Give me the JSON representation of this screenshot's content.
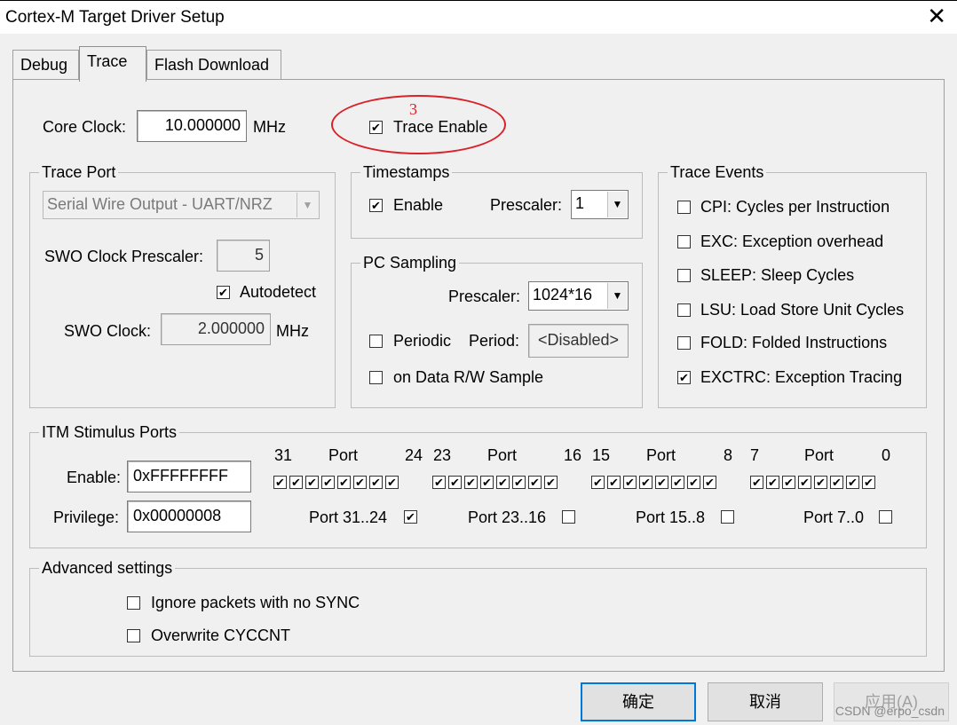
{
  "window": {
    "title": "Cortex-M Target Driver Setup"
  },
  "tabs": [
    {
      "label": "Debug"
    },
    {
      "label": "Trace"
    },
    {
      "label": "Flash Download"
    }
  ],
  "core_clock": {
    "label": "Core Clock:",
    "value": "10.000000",
    "unit": "MHz"
  },
  "trace_enable": {
    "label": "Trace Enable",
    "checked": true
  },
  "annotation": {
    "number": "3"
  },
  "trace_port": {
    "title": "Trace Port",
    "selected": "Serial Wire Output - UART/NRZ",
    "swo_prescaler_label": "SWO Clock Prescaler:",
    "swo_prescaler_value": "5",
    "autodetect_label": "Autodetect",
    "autodetect_checked": true,
    "swo_clock_label": "SWO Clock:",
    "swo_clock_value": "2.000000",
    "swo_clock_unit": "MHz"
  },
  "timestamps": {
    "title": "Timestamps",
    "enable_label": "Enable",
    "enable_checked": true,
    "prescaler_label": "Prescaler:",
    "prescaler_value": "1"
  },
  "pc_sampling": {
    "title": "PC Sampling",
    "prescaler_label": "Prescaler:",
    "prescaler_value": "1024*16",
    "periodic_label": "Periodic",
    "periodic_checked": false,
    "period_label": "Period:",
    "period_value": "<Disabled>",
    "on_data_label": "on Data R/W Sample",
    "on_data_checked": false
  },
  "trace_events": {
    "title": "Trace Events",
    "items": [
      {
        "label": "CPI: Cycles per Instruction",
        "checked": false
      },
      {
        "label": "EXC: Exception overhead",
        "checked": false
      },
      {
        "label": "SLEEP: Sleep Cycles",
        "checked": false
      },
      {
        "label": "LSU: Load Store Unit Cycles",
        "checked": false
      },
      {
        "label": "FOLD: Folded Instructions",
        "checked": false
      },
      {
        "label": "EXCTRC: Exception Tracing",
        "checked": true
      }
    ]
  },
  "itm": {
    "title": "ITM Stimulus Ports",
    "enable_label": "Enable:",
    "enable_value": "0xFFFFFFFF",
    "privilege_label": "Privilege:",
    "privilege_value": "0x00000008",
    "groups": [
      {
        "hi": "31",
        "port": "Port",
        "lo": "24",
        "priv_label": "Port 31..24",
        "priv_checked": true
      },
      {
        "hi": "23",
        "port": "Port",
        "lo": "16",
        "priv_label": "Port 23..16",
        "priv_checked": false
      },
      {
        "hi": "15",
        "port": "Port",
        "lo": "8",
        "priv_label": "Port 15..8",
        "priv_checked": false
      },
      {
        "hi": "7",
        "port": "Port",
        "lo": "0",
        "priv_label": "Port 7..0",
        "priv_checked": false
      }
    ]
  },
  "advanced": {
    "title": "Advanced settings",
    "ignore_label": "Ignore packets with no SYNC",
    "ignore_checked": false,
    "overwrite_label": "Overwrite CYCCNT",
    "overwrite_checked": false
  },
  "buttons": {
    "ok": "确定",
    "cancel": "取消",
    "apply": "应用(A)"
  },
  "watermark": "CSDN @erpo_csdn",
  "icons": {
    "checkbox_checked": "✔",
    "dropdown_arrow": "▼",
    "close": "✕"
  },
  "colors": {
    "annotation_red": "#d8232a",
    "default_button_border": "#0078d7"
  }
}
